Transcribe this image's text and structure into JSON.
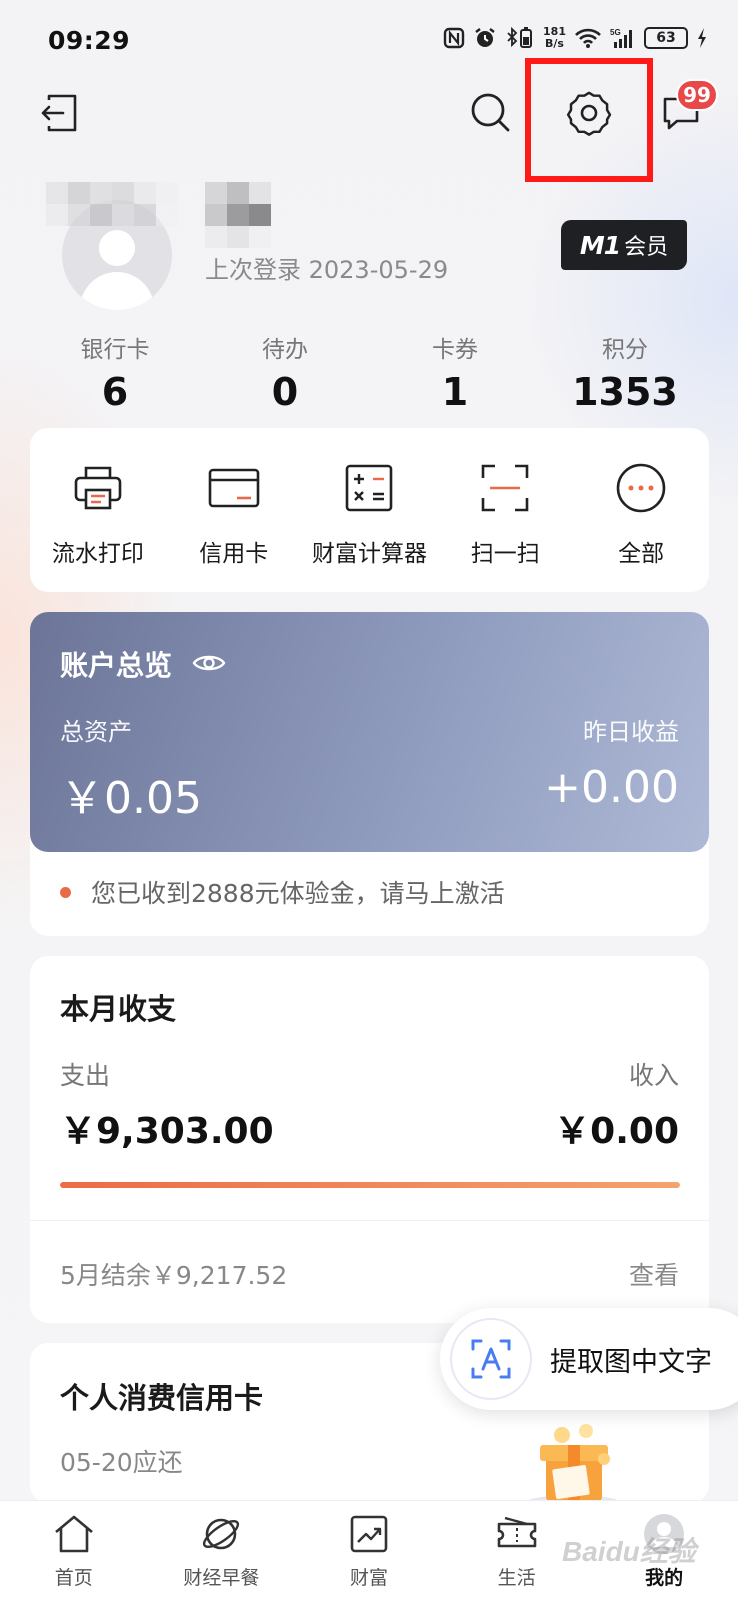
{
  "status_bar": {
    "time": "09:29",
    "net_speed_top": "181",
    "net_speed_bottom": "B/s",
    "battery": "63"
  },
  "topbar": {
    "back_icon": "exit-icon",
    "search_icon": "search-icon",
    "settings_icon": "gear-icon",
    "messages_icon": "message-icon",
    "messages_badge": "99"
  },
  "profile": {
    "last_login": "上次登录 2023-05-29",
    "member_badge_prefix": "M1",
    "member_badge_label": "会员"
  },
  "stats": [
    {
      "label": "银行卡",
      "value": "6"
    },
    {
      "label": "待办",
      "value": "0"
    },
    {
      "label": "卡券",
      "value": "1"
    },
    {
      "label": "积分",
      "value": "1353"
    }
  ],
  "quick_actions": [
    {
      "label": "流水打印",
      "icon": "printer-icon"
    },
    {
      "label": "信用卡",
      "icon": "credit-card-icon"
    },
    {
      "label": "财富计算器",
      "icon": "calculator-icon"
    },
    {
      "label": "扫一扫",
      "icon": "scan-icon"
    },
    {
      "label": "全部",
      "icon": "more-icon"
    }
  ],
  "overview": {
    "title": "账户总览",
    "total_assets_label": "总资产",
    "total_assets_value": "￥0.05",
    "yesterday_label": "昨日收益",
    "yesterday_value": "+0.00",
    "notice": "您已收到2888元体验金，请马上激活"
  },
  "monthly": {
    "title": "本月收支",
    "expense_label": "支出",
    "expense_value": "￥9,303.00",
    "income_label": "收入",
    "income_value": "￥0.00",
    "expense_share": 1.0,
    "balance": "5月结余￥9,217.52",
    "view_label": "查看"
  },
  "credit": {
    "title": "个人消费信用卡",
    "due": "05-20应还"
  },
  "floating": {
    "label": "提取图中文字"
  },
  "bottom_nav": [
    {
      "label": "首页",
      "icon": "home-icon"
    },
    {
      "label": "财经早餐",
      "icon": "planet-icon"
    },
    {
      "label": "财富",
      "icon": "trend-chart-icon"
    },
    {
      "label": "生活",
      "icon": "ticket-icon"
    },
    {
      "label": "我的",
      "icon": "user-icon"
    }
  ],
  "watermark": "Baidu经验",
  "colors": {
    "accent": "#e86a46",
    "highlight": "#ff1a1a",
    "overview_start": "#6c7598",
    "overview_end": "#aeb9d6",
    "badge": "#e84848"
  }
}
